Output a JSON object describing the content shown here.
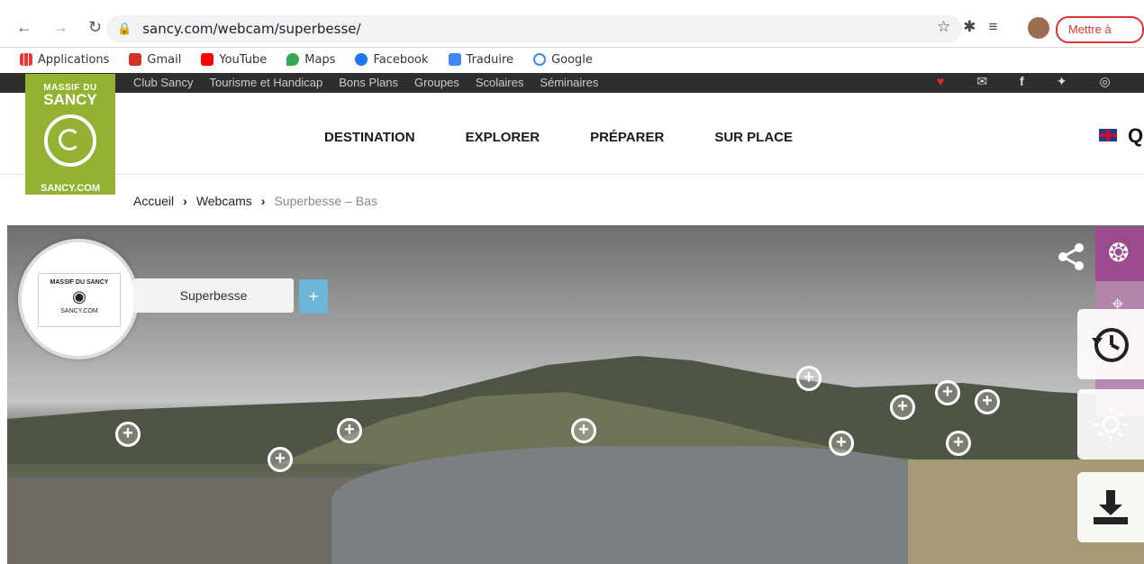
{
  "browser": {
    "url": "sancy.com/webcam/superbesse/",
    "update_label": "Mettre à jour",
    "bookmarks": [
      "Applications",
      "Gmail",
      "YouTube",
      "Maps",
      "Facebook",
      "Traduire",
      "Google"
    ]
  },
  "topbar": {
    "links": [
      "Club Sancy",
      "Tourisme et Handicap",
      "Bons Plans",
      "Groupes",
      "Scolaires",
      "Séminaires"
    ]
  },
  "logo": {
    "line1": "MASSIF DU",
    "line2": "SANCY",
    "line3": "SANCY.COM"
  },
  "mainnav": [
    "DESTINATION",
    "EXPLORER",
    "PRÉPARER",
    "SUR PLACE"
  ],
  "breadcrumb": {
    "home": "Accueil",
    "section": "Webcams",
    "current": "Superbesse – Bas"
  },
  "webcam": {
    "camera_name": "Superbesse",
    "plus_label": "+",
    "circle_logo_text": "MASSIF DU SANCY",
    "circle_logo_url": "SANCY.COM"
  },
  "colors": {
    "brand_green": "#94b231",
    "topbar": "#2e2e2e",
    "accent_purple": "#9b4a8e",
    "plus_blue": "#6cb6d8"
  },
  "icons": {
    "share": "share-icon",
    "history": "history-icon",
    "brightness": "brightness-icon",
    "download": "download-icon"
  }
}
